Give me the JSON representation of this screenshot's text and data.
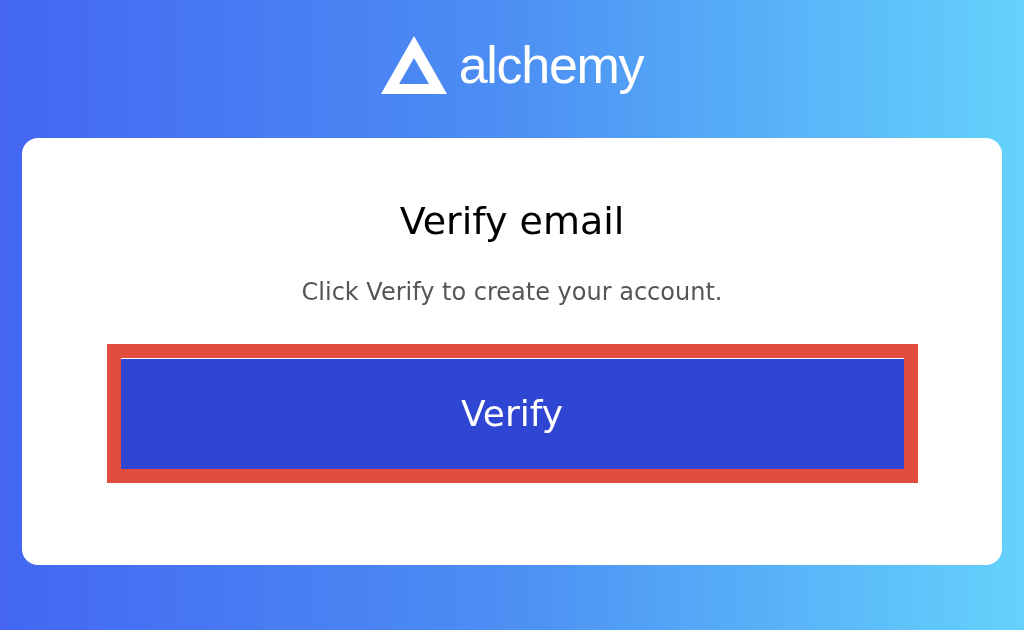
{
  "logo": {
    "text": "alchemy"
  },
  "card": {
    "title": "Verify email",
    "message": "Click Verify to create your account."
  },
  "button": {
    "label": "Verify",
    "highlighted": true
  }
}
